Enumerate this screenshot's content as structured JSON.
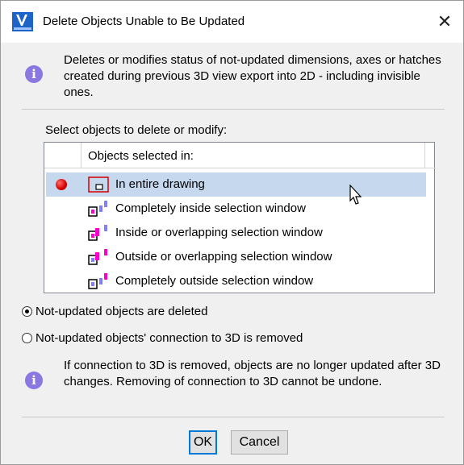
{
  "window": {
    "title": "Delete Objects Unable to Be Updated",
    "close_glyph": "✕"
  },
  "description": "Deletes or modifies status of not-updated dimensions, axes or hatches created during previous 3D view export into 2D - including invisible ones.",
  "prompt": "Select objects to delete or modify:",
  "list": {
    "header": "Objects selected in:",
    "items": [
      {
        "label": "In entire drawing",
        "selected": true,
        "icon": "entire-drawing-icon"
      },
      {
        "label": "Completely inside selection window",
        "selected": false,
        "icon": "inside-window-icon"
      },
      {
        "label": "Inside or overlapping selection window",
        "selected": false,
        "icon": "inside-overlapping-icon"
      },
      {
        "label": "Outside or overlapping selection window",
        "selected": false,
        "icon": "outside-overlapping-icon"
      },
      {
        "label": "Completely outside selection window",
        "selected": false,
        "icon": "outside-window-icon"
      }
    ]
  },
  "options": {
    "delete_label": "Not-updated objects are deleted",
    "remove_connection_label": "Not-updated objects' connection to 3D is removed",
    "selected": "delete"
  },
  "note": "If connection to 3D is removed, objects are no longer updated after 3D changes. Removing of connection to 3D cannot be undone.",
  "buttons": {
    "ok": "OK",
    "cancel": "Cancel"
  },
  "colors": {
    "accent": "#0078d7",
    "selection": "#c6d8ee",
    "info_icon": "#8a78e0",
    "marker_red": "#d40000",
    "icon_magenta": "#ff00cc",
    "icon_blue": "#7f7fff"
  }
}
